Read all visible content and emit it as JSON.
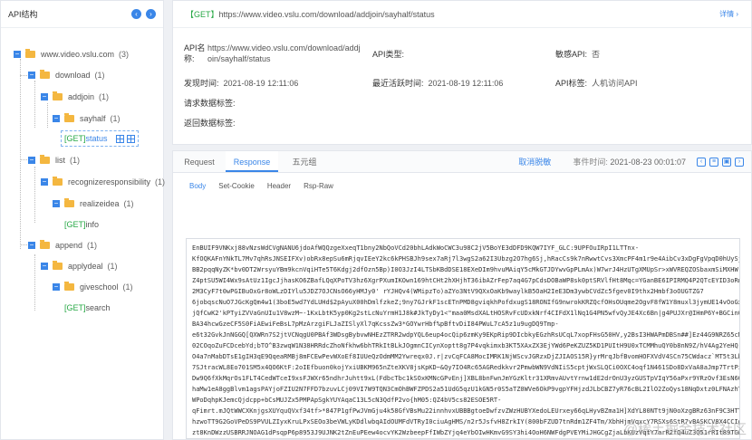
{
  "left_panel": {
    "title": "API结构",
    "tree": [
      {
        "label": "www.video.vslu.com",
        "count": "(3)"
      },
      {
        "label": "download",
        "count": "(1)"
      },
      {
        "label": "addjoin",
        "count": "(1)"
      },
      {
        "label": "sayhalf",
        "count": "(1)"
      },
      {
        "method": "[GET]",
        "label": "status"
      },
      {
        "label": "list",
        "count": "(1)"
      },
      {
        "label": "recognizeresponsibility",
        "count": "(1)"
      },
      {
        "label": "realizeidea",
        "count": "(1)"
      },
      {
        "method": "[GET]",
        "label": "info"
      },
      {
        "label": "append",
        "count": "(1)"
      },
      {
        "label": "applydeal",
        "count": "(1)"
      },
      {
        "label": "giveschool",
        "count": "(1)"
      },
      {
        "method": "[GET]",
        "label": "search"
      }
    ]
  },
  "top": {
    "method": "【GET】",
    "url": "https://www.video.vslu.com/download/addjoin/sayhalf/status",
    "detail": "详情 ›",
    "api_name_label": "API名称:",
    "api_name_value_1": "https://www.video.vslu.com/download/addj",
    "api_name_value_2": "oin/sayhalf/status",
    "api_type_label": "API类型:",
    "sensitive_label": "敏感API:",
    "sensitive_value": "否",
    "discover_label": "发现时间:",
    "discover_value": "2021-08-19 12:11:06",
    "recent_label": "最近活跃时间:",
    "recent_value": "2021-08-19 12:11:06",
    "tag_label": "API标签:",
    "tag_value": "人机访问API",
    "req_label": "请求数据标签:",
    "resp_label": "返回数据标签:"
  },
  "bottom": {
    "tabs": [
      "Request",
      "Response",
      "五元组"
    ],
    "format_btn": "取消脱敏",
    "time_label": "事件时间:",
    "time_value": "2021-08-23 00:01:07",
    "subtabs": [
      "Body",
      "Set-Cookie",
      "Header",
      "Rsp-Raw"
    ],
    "code_lines": [
      "EnBUIF9VNKxj88vNzsWdCVgNANU6jdoAfWQQzgeXxeqT1bny2NbQoVCd20bhLAdkWoCWC3u98C2jV5BoYE3dDFD9KQW7IYF_GLC:9UPFOuIRpI1LTTnx-",
      "KfOQKAFnYNkTL7Mv7qhRsJNSEIFXv)obRx8epSu6mRjqvIEeY2kc6kPHSBJh9sex7aRj7l3wgS2a62I3Ubzg2O7hg6Sj,hRacCs9k7nRwwtCvs3XmcPF4m1r9e4AibCv3xDgFgVpqD0hUySj40KSvMZ",
      "BB2pqqNyZK*bv0DT2WrsyuYBm9kcnVqiHTe5T6Kdgj2dfOzn5Bp)I0O3JzI4LTSbKBdDSE18EXeDIm9hvuMAiqY5cMkGTJDYwvGpPLmAx)W7wrJ4HzUTgXMUpSr>xWVREQZOSbaxmSiMXHW",
      "Z4ptSU5WI4Wx9sAtUz1IgcJjhasKO6ZBafLQqXPoTV3hz6XgrPXumIKOwn169htCHt2hXHjhT36ibAZrFep7aq4G7pCdsDOBaWP8sk0ptSRVlfHt8Mqc=YGanBE6IPIRMQ4P2QTcEYID3oRnUKkdqd",
      "2M3CyF7t0wPGIBuOxGr8oWLzDIYlu5JDZ7OJCNsO66yHMJy0' rYJHQv4(WMipzTo)aZYo3NtV9QXxOaKb9waylkB5OaH2IeE3Dm3ywbCVdZc5fgev0I9thx2Hmbf3oOUGTZG7",
      "6jobqscNuO7JGcKgQm4w1(3boE5wd7YdLUHd$2pAyuX00hDmlfzkeZ;9ny7GJrkF1scETnPMD8gviqkhPofdxugS18RONIfG9nwrokKRZQcfOHsOUqme2OgvF8fW1Y8muxl3jymUE14vOoGx9VA",
      "jQfCwK2'kPTyiZVVaGnUIu1V8wzM~-1KxLbtK5yp0Kg2stLcNuYrmH1J8k#JkTyDy1<\"maa0MsdXALtHOSRvFcUDxkNrf4CIFdX1lNq1G4PN5wfvQyJE4Xc6Bn|g4PUJXr@IHmP6Y+BGCinGaW]c",
      "BA34hcwGzeCF5S0FiAEwiFeBsL7pMzArzgiFLJaZISlyXl7qKcssZw3*GOYwrHbf%pBftvDiI84PWuL7cA5z1u9ugDQ9Tmp-",
      "e6t32GvkJnNGGQ[QXWRn7S2jtVCNqgU0PBAf3WDsgBybvwNHEzZTRR2wdpYQL6eup4ocQip6zmKy9EKpRip9DIcbkyEGzhRsUCqL7xopFHsG50HV,y2BsI3HWAPmDBSn##]Ez44G9NRZ65cNIp",
      "02COqoZuFCDcebYd;bTO^B3zwqW1N38HRRdcZhoNfkhw6bhTRkItBLkJOgmnCICynXoptt8g7P4vqkimxb3KT5XAxZX3EjYWd6PeKZUZ5KD1PUItH9U0xTCMMhuQY0b8nN9Z/hV4Ag2YeHQ",
      "O4a7nMabDTsE1gIH3qE9QqeaRMBj8mFCEwPevWXoEf8IUUeQzOdmMM2Ywreqx0J.r|zvCqFCA8MocIMRK1NjWScvJGRzxDjZJIAOS15R}yrMrqJbfBvomHOFXVdV4SCn75CWdacz`MT5t3Lbg2",
      "7SJtracWL8Eo701SM5x4QO6KtF:2oIEfbuon0kojYxiUBKM965nZteXKV8jsKpKD~&Qy7IO4Rc65AGRedkkvr2PmwbWN9VdNIiS5cptjWxSLQCi0OXC4oqf1N461SDo8DxVaA8aJmp7TrtPiy34wTw",
      "Dw9Q6fXkMqrOs1FLT4CedWTceI9xsFJWXr65ndhrJuhtt9xL(FdbcTbc1kSOxKMNcGPvEnj]XBL8bnFwnJmYGzKltr31XRmvAUvtYrnw1dE2drOnU3yzGUSTpVIqY56aPxr9YRzOvf3EsN6Gv8nIg882",
      "haMw1eA8ggBlvm1agsPAYjoFZIU2N7FFD7bzuvLCj09VI7W9TQN3CmOhBWFZPDS2a51UdG5qzU1kGN5r0S5aTZ0WVe6OkP9vgpYFHjzdJLbCBZ7yR76cBL2IlO2ZoQys18NqDxtz0LFNAzhT0",
      "WPoDqhpKJemcQjdcpp+bCsMUJZx5PMPApSgkYUYAqaC13L5cN3QdfP2vo{hM05:QZ4bV5cs82ESOE5RT-",
      "qFimrt.mJQtWWCXKnjgsXUYquQVxf34tf>*847P1gfPwJVmGju4k58GfVBsMu22innhvxUBBBgtoeDwfzvZWzHUBYXedoLEUrxey66qLHyvBZma1H]XdYL80NTt9jN0oXzgBRz63nF9C3HTT3S",
      "hzwoTT9G2GoVPeDS9PVULZIyxKruLPxSEOo3beVWLyKDdlwbqAIdOUMFdVTRyI0ciuAgHMS/n2r5JsfvH8ZrkIY(800bFZUD7tnRdm1ZF4Tm/XbhHjmVqxcY7RSXs6StR7vBASKCV8X4CCIgb3",
      "zt8KnDWzzUSBRRJNOAG1dPsqpP6p8953J9UJNK2tZnEuPEew4ocvYK2WzbeepFfIWbZYjq4eYbOIwHKmvG9SY3hi4OoH6NWFdgPVEYMiJHGCgZjaLbKUzVqtY7arR2fQ4uZ3Q51rRIt89TGd3b"
    ]
  },
  "watermark": "@稀土掘金技术社区"
}
